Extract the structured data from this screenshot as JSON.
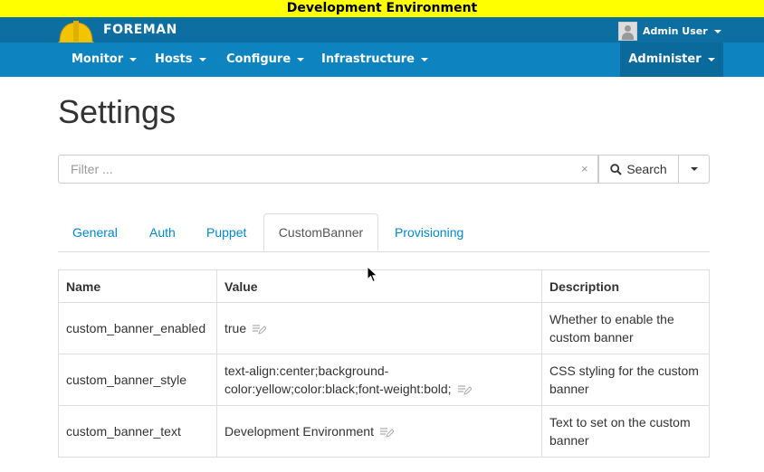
{
  "banner": {
    "text": "Development Environment"
  },
  "brand": {
    "name": "FOREMAN"
  },
  "user": {
    "name": "Admin User"
  },
  "nav": {
    "monitor": "Monitor",
    "hosts": "Hosts",
    "configure": "Configure",
    "infrastructure": "Infrastructure",
    "administer": "Administer"
  },
  "page": {
    "title": "Settings"
  },
  "search": {
    "placeholder": "Filter ...",
    "clear": "×",
    "button_label": "Search"
  },
  "tabs": [
    "General",
    "Auth",
    "Puppet",
    "CustomBanner",
    "Provisioning"
  ],
  "table": {
    "headers": [
      "Name",
      "Value",
      "Description"
    ],
    "rows": [
      {
        "name": "custom_banner_enabled",
        "value": "true",
        "description": "Whether to enable the custom banner"
      },
      {
        "name": "custom_banner_style",
        "value": "text-align:center;background-color:yellow;color:black;font-weight:bold;",
        "description": "CSS styling for the custom banner"
      },
      {
        "name": "custom_banner_text",
        "value": "Development Environment",
        "description": "Text to set on the custom banner"
      }
    ]
  },
  "colors": {
    "banner_bg": "#ffff00",
    "topbar": "#0c6ea1",
    "navbar": "#0d83bf",
    "link": "#0088cc"
  }
}
